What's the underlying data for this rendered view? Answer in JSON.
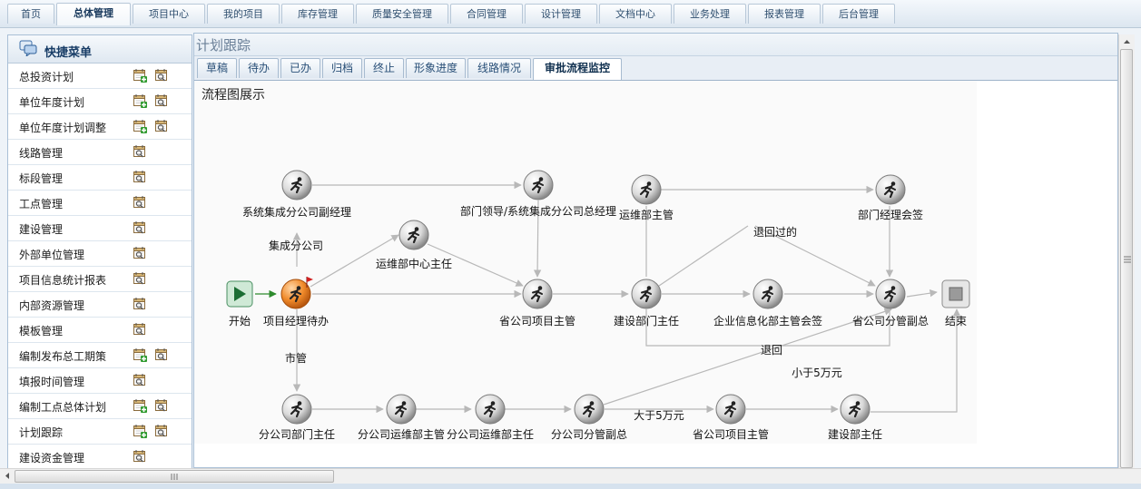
{
  "topnav": {
    "tabs": [
      "首页",
      "总体管理",
      "项目中心",
      "我的项目",
      "库存管理",
      "质量安全管理",
      "合同管理",
      "设计管理",
      "文档中心",
      "业务处理",
      "报表管理",
      "后台管理"
    ],
    "active_index": 1
  },
  "sidebar": {
    "title": "快捷菜单",
    "items": [
      {
        "label": "总投资计划",
        "icons": [
          "add-calendar-icon",
          "search-calendar-icon"
        ]
      },
      {
        "label": "单位年度计划",
        "icons": [
          "add-calendar-icon",
          "search-calendar-icon"
        ]
      },
      {
        "label": "单位年度计划调整",
        "icons": [
          "add-calendar-icon",
          "search-calendar-icon"
        ]
      },
      {
        "label": "线路管理",
        "icons": [
          "search-calendar-icon"
        ]
      },
      {
        "label": "标段管理",
        "icons": [
          "search-calendar-icon"
        ]
      },
      {
        "label": "工点管理",
        "icons": [
          "search-calendar-icon"
        ]
      },
      {
        "label": "建设管理",
        "icons": [
          "search-calendar-icon"
        ]
      },
      {
        "label": "外部单位管理",
        "icons": [
          "search-calendar-icon"
        ]
      },
      {
        "label": "项目信息统计报表",
        "icons": [
          "search-calendar-icon"
        ]
      },
      {
        "label": "内部资源管理",
        "icons": [
          "search-calendar-icon"
        ]
      },
      {
        "label": "模板管理",
        "icons": [
          "search-calendar-icon"
        ]
      },
      {
        "label": "编制发布总工期策",
        "icons": [
          "add-calendar-icon",
          "search-calendar-icon"
        ]
      },
      {
        "label": "填报时间管理",
        "icons": [
          "search-calendar-icon"
        ]
      },
      {
        "label": "编制工点总体计划",
        "icons": [
          "add-calendar-icon",
          "search-calendar-icon"
        ]
      },
      {
        "label": "计划跟踪",
        "icons": [
          "add-calendar-icon",
          "search-calendar-icon"
        ]
      },
      {
        "label": "建设资金管理",
        "icons": [
          "search-calendar-icon"
        ]
      }
    ]
  },
  "main": {
    "panel_title": "计划跟踪",
    "tabs": [
      "草稿",
      "待办",
      "已办",
      "归档",
      "终止",
      "形象进度",
      "线路情况",
      "审批流程监控"
    ],
    "active_tab_index": 7,
    "flow_title": "流程图展示"
  },
  "flow": {
    "nodes": {
      "start": "开始",
      "pm_todo": "项目经理待办",
      "sys_vice": "系统集成分公司副经理",
      "ops_center": "运维部中心主任",
      "dept_leader": "部门领导/系统集成分公司总经理",
      "prov_pm": "省公司项目主管",
      "ops_head": "运维部主管",
      "build_head": "建设部门主任",
      "ent_info": "企业信息化部主管会签",
      "dept_mgr_sign": "部门经理会签",
      "prov_vice": "省公司分管副总",
      "end": "结束",
      "branch_dept": "分公司部门主任",
      "branch_ops_mgr": "分公司运维部主管",
      "branch_ops_dir": "分公司运维部主任",
      "branch_vice": "分公司分管副总",
      "prov_pm2": "省公司项目主管",
      "build_dir": "建设部主任"
    },
    "edge_labels": {
      "integration": "集成分公司",
      "city": "市管",
      "returned": "退回过的",
      "return": "退回",
      "under5": "小于5万元",
      "over5": "大于5万元"
    }
  }
}
